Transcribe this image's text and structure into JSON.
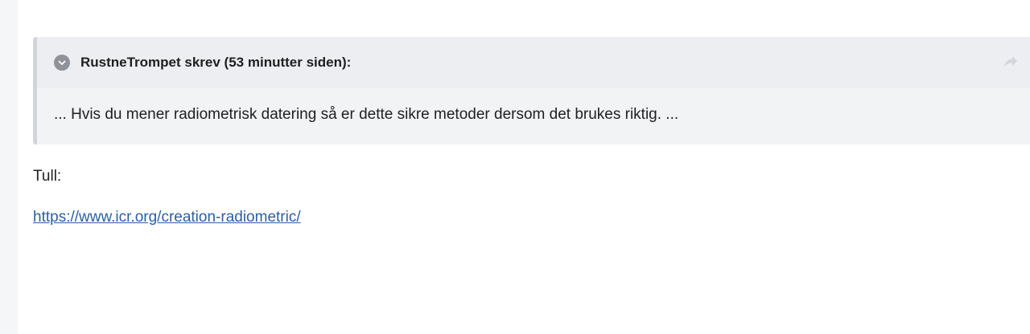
{
  "quote": {
    "citation": "RustneTrompet skrev (53 minutter siden):",
    "body": "... Hvis du mener radiometrisk datering så er dette sikre metoder dersom det brukes riktig. ...",
    "toggle_icon": "chevron-down-icon",
    "share_icon": "share-icon"
  },
  "reply": {
    "text": "Tull:",
    "link": "https://www.icr.org/creation-radiometric/"
  },
  "colors": {
    "quote_bg": "#f2f3f5",
    "quote_border": "#d1d4d9",
    "link": "#2a5fa8"
  }
}
